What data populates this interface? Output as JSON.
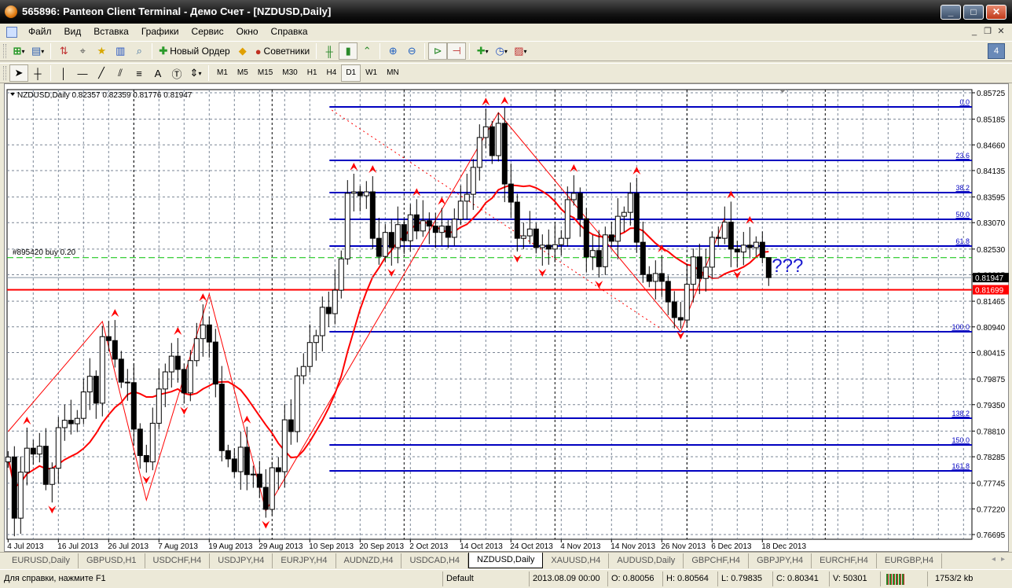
{
  "window": {
    "title": "565896: Panteon Client Terminal - Демо Счет - [NZDUSD,Daily]"
  },
  "menu": [
    "Файл",
    "Вид",
    "Вставка",
    "Графики",
    "Сервис",
    "Окно",
    "Справка"
  ],
  "toolbar": {
    "new_order": "Новый Ордер",
    "experts": "Советники"
  },
  "timeframes": [
    "M1",
    "M5",
    "M15",
    "M30",
    "H1",
    "H4",
    "D1",
    "W1",
    "MN"
  ],
  "active_timeframe": "D1",
  "chart": {
    "header": "NZDUSD,Daily  0.82357 0.82359 0.81776 0.81947",
    "order_label": "#895420 buy 0.20",
    "annotation": "???",
    "bid_label": "0.81947",
    "red_line_label": "0.81699"
  },
  "tabs": [
    "EURUSD,Daily",
    "GBPUSD,H1",
    "USDCHF,H4",
    "USDJPY,H4",
    "EURJPY,H4",
    "AUDNZD,H4",
    "USDCAD,H4",
    "NZDUSD,Daily",
    "XAUUSD,H4",
    "AUDUSD,Daily",
    "GBPCHF,H4",
    "GBPJPY,H4",
    "EURCHF,H4",
    "EURGBP,H4"
  ],
  "active_tab": "NZDUSD,Daily",
  "status": {
    "help": "Для справки, нажмите F1",
    "profile": "Default",
    "time": "2013.08.09 00:00",
    "open": "O: 0.80056",
    "high": "H: 0.80564",
    "low": "L: 0.79835",
    "close": "C: 0.80341",
    "volume": "V: 50301",
    "traffic": "1753/2 kb"
  },
  "colors": {
    "bull_body": "#ffffff",
    "bear_body": "#000000",
    "ma": "#ff0000",
    "fib": "#0000c0",
    "order_line": "#00c000",
    "support": "#ff0000",
    "annotation": "#1a1ad0"
  },
  "chart_data": {
    "type": "candlestick",
    "symbol": "NZDUSD",
    "timeframe": "Daily",
    "ylim": [
      0.76695,
      0.85725
    ],
    "y_ticks": [
      "0.85725",
      "0.85185",
      "0.84660",
      "0.84135",
      "0.83595",
      "0.83070",
      "0.82530",
      "0.82005",
      "0.81465",
      "0.80940",
      "0.80415",
      "0.79875",
      "0.79350",
      "0.78810",
      "0.78285",
      "0.77745",
      "0.77220",
      "0.76695"
    ],
    "x_labels": [
      {
        "bar": 0,
        "label": "4 Jul 2013"
      },
      {
        "bar": 8,
        "label": "16 Jul 2013"
      },
      {
        "bar": 16,
        "label": "26 Jul 2013"
      },
      {
        "bar": 24,
        "label": "7 Aug 2013"
      },
      {
        "bar": 32,
        "label": "19 Aug 2013"
      },
      {
        "bar": 40,
        "label": "29 Aug 2013"
      },
      {
        "bar": 48,
        "label": "10 Sep 2013"
      },
      {
        "bar": 56,
        "label": "20 Sep 2013"
      },
      {
        "bar": 64,
        "label": "2 Oct 2013"
      },
      {
        "bar": 72,
        "label": "14 Oct 2013"
      },
      {
        "bar": 80,
        "label": "24 Oct 2013"
      },
      {
        "bar": 88,
        "label": "4 Nov 2013"
      },
      {
        "bar": 96,
        "label": "14 Nov 2013"
      },
      {
        "bar": 104,
        "label": "26 Nov 2013"
      },
      {
        "bar": 112,
        "label": "6 Dec 2013"
      },
      {
        "bar": 120,
        "label": "18 Dec 2013"
      }
    ],
    "period_separators": [
      20,
      42,
      63,
      87,
      108,
      130
    ],
    "closes": [
      0.7828,
      0.7703,
      0.7797,
      0.7846,
      0.7834,
      0.785,
      0.7772,
      0.7805,
      0.7888,
      0.7903,
      0.7896,
      0.7907,
      0.7961,
      0.7993,
      0.7938,
      0.8074,
      0.8066,
      0.8028,
      0.7981,
      0.798,
      0.7885,
      0.7831,
      0.7818,
      0.7897,
      0.7967,
      0.8002,
      0.80341,
      0.8007,
      0.7959,
      0.8025,
      0.807,
      0.8098,
      0.8063,
      0.7977,
      0.7841,
      0.7824,
      0.7798,
      0.7848,
      0.7792,
      0.7793,
      0.7766,
      0.7721,
      0.7806,
      0.7798,
      0.7904,
      0.788,
      0.7994,
      0.8013,
      0.8062,
      0.8076,
      0.8134,
      0.8121,
      0.8169,
      0.8233,
      0.8367,
      0.837,
      0.8362,
      0.837,
      0.8275,
      0.8238,
      0.8287,
      0.8256,
      0.8303,
      0.827,
      0.8323,
      0.829,
      0.8311,
      0.83,
      0.8287,
      0.83,
      0.8277,
      0.8314,
      0.8351,
      0.8365,
      0.842,
      0.8481,
      0.8503,
      0.8444,
      0.851,
      0.8386,
      0.8349,
      0.8275,
      0.828,
      0.8294,
      0.8256,
      0.8261,
      0.8253,
      0.8262,
      0.8275,
      0.8354,
      0.8367,
      0.8315,
      0.8237,
      0.825,
      0.8217,
      0.8282,
      0.8269,
      0.832,
      0.8328,
      0.8367,
      0.8267,
      0.8201,
      0.8187,
      0.8203,
      0.8187,
      0.8145,
      0.8113,
      0.8108,
      0.8181,
      0.8237,
      0.8193,
      0.8216,
      0.8277,
      0.8275,
      0.8308,
      0.8253,
      0.8247,
      0.8261,
      0.8256,
      0.8267,
      0.82357,
      0.81947
    ],
    "last_bar": {
      "open": 0.82357,
      "high": 0.82359,
      "low": 0.81776,
      "close": 0.81947
    },
    "fibonacci": {
      "from_bar": 51,
      "levels": [
        {
          "label": "0.0",
          "price": 0.85436
        },
        {
          "label": "23.6",
          "price": 0.84343
        },
        {
          "label": "38.2",
          "price": 0.83684
        },
        {
          "label": "50.0",
          "price": 0.83138
        },
        {
          "label": "61.8",
          "price": 0.82592
        },
        {
          "label": "100.0",
          "price": 0.80841
        },
        {
          "label": "138.2",
          "price": 0.79073
        },
        {
          "label": "150.0",
          "price": 0.78527
        },
        {
          "label": "161.8",
          "price": 0.77997
        }
      ]
    },
    "zigzag": [
      [
        0,
        0.788
      ],
      [
        15,
        0.8105
      ],
      [
        22,
        0.774
      ],
      [
        32,
        0.8161
      ],
      [
        41,
        0.7718
      ],
      [
        78,
        0.8532
      ],
      [
        107,
        0.8084
      ],
      [
        114,
        0.8317
      ]
    ],
    "trendline_dotted": [
      [
        51.5,
        0.8537
      ],
      [
        104,
        0.8089
      ]
    ],
    "order_price": 0.82354,
    "bid": 0.81947,
    "support_price": 0.81699,
    "annotation_at": [
      121.5,
      0.8222
    ]
  }
}
